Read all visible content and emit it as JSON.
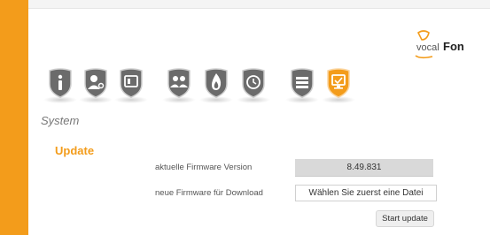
{
  "logo": {
    "text_prefix": "vocal",
    "text_suffix": "Fon"
  },
  "nav": {
    "items": [
      {
        "name": "info",
        "icon": "info-icon",
        "active": false
      },
      {
        "name": "user-settings",
        "icon": "user-settings-icon",
        "active": false
      },
      {
        "name": "phone",
        "icon": "phone-icon",
        "active": false
      },
      {
        "name": "contacts",
        "icon": "contacts-icon",
        "active": false
      },
      {
        "name": "fire",
        "icon": "fire-icon",
        "active": false
      },
      {
        "name": "alarm-clock",
        "icon": "alarm-clock-icon",
        "active": false
      },
      {
        "name": "network",
        "icon": "network-icon",
        "active": false
      },
      {
        "name": "system",
        "icon": "monitor-icon",
        "active": true
      }
    ],
    "inactive_color": "#6b6b6b",
    "active_color": "#f39c1b"
  },
  "section": {
    "title": "System",
    "subtitle": "Update"
  },
  "form": {
    "firmware_label": "aktuelle Firmware Version",
    "firmware_value": "8.49.831",
    "download_label": "neue Firmware für Download",
    "file_button": "Wählen Sie zuerst eine Datei",
    "start_button": "Start update"
  },
  "colors": {
    "accent": "#f39c1b"
  }
}
